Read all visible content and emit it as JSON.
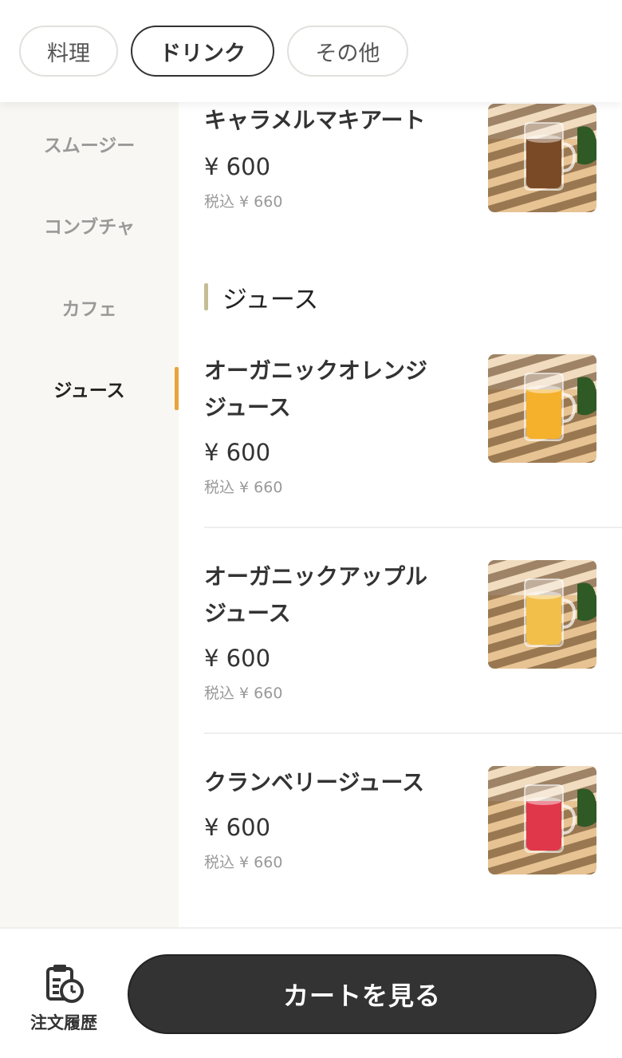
{
  "tabs": [
    {
      "label": "料理",
      "active": false
    },
    {
      "label": "ドリンク",
      "active": true
    },
    {
      "label": "その他",
      "active": false
    }
  ],
  "side_nav": {
    "items": [
      {
        "label": "スムージー",
        "active": false
      },
      {
        "label": "コンブチャ",
        "active": false
      },
      {
        "label": "カフェ",
        "active": false
      },
      {
        "label": "ジュース",
        "active": true
      }
    ]
  },
  "section": {
    "title": "ジュース"
  },
  "items": [
    {
      "name": "キャラメルマキアート",
      "price": "¥ 600",
      "tax": "税込 ¥ 660",
      "drink_color": "#7a4a26"
    },
    {
      "name": "オーガニックオレンジジュース",
      "price": "¥ 600",
      "tax": "税込 ¥ 660",
      "drink_color": "#f5b12c"
    },
    {
      "name": "オーガニックアップルジュース",
      "price": "¥ 600",
      "tax": "税込 ¥ 660",
      "drink_color": "#f2c04a"
    },
    {
      "name": "クランベリージュース",
      "price": "¥ 600",
      "tax": "税込 ¥ 660",
      "drink_color": "#e0374a"
    }
  ],
  "bottom": {
    "history_label": "注文履歴",
    "cart_label": "カートを見る"
  },
  "colors": {
    "accent": "#e8a33a",
    "section_bar": "#c5bd94",
    "cart_button": "#333333",
    "sidebar_bg": "#f8f7f3"
  }
}
